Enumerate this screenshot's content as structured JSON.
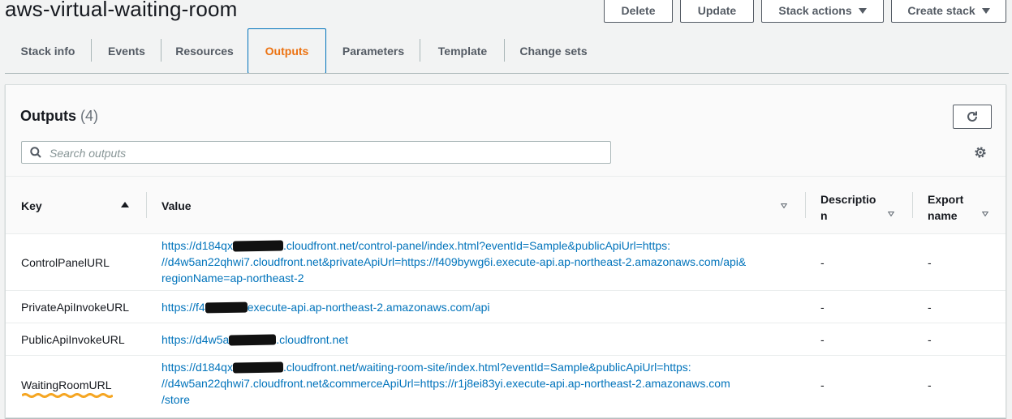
{
  "header": {
    "title": "aws-virtual-waiting-room",
    "buttons": {
      "delete": "Delete",
      "update": "Update",
      "stack_actions": "Stack actions",
      "create_stack": "Create stack"
    }
  },
  "tabs": [
    "Stack info",
    "Events",
    "Resources",
    "Outputs",
    "Parameters",
    "Template",
    "Change sets"
  ],
  "active_tab": "Outputs",
  "outputs": {
    "title": "Outputs",
    "count": "(4)",
    "search_placeholder": "Search outputs",
    "columns": {
      "key": "Key",
      "value": "Value",
      "description_1": "Descriptio",
      "description_2": "n",
      "export_1": "Export",
      "export_2": "name"
    },
    "rows": [
      {
        "key": "ControlPanelURL",
        "value_lines": [
          [
            "https://d184qx",
            ".cloudfront.net/control-panel/index.html?eventId=Sample&publicApiUrl=https:"
          ],
          [
            "//d4w5an22qhwi7.cloudfront.net&privateApiUrl=https://f409bywg6i.execute-api.ap-northeast-2.amazonaws.com/api&"
          ],
          [
            "regionName=ap-northeast-2"
          ]
        ],
        "description": "-",
        "export_name": "-"
      },
      {
        "key": "PrivateApiInvokeURL",
        "value_lines": [
          [
            "https://f4",
            "execute-api.ap-northeast-2.amazonaws.com/api"
          ]
        ],
        "description": "-",
        "export_name": "-"
      },
      {
        "key": "PublicApiInvokeURL",
        "value_lines": [
          [
            "https://d4w5a",
            ".cloudfront.net"
          ]
        ],
        "description": "-",
        "export_name": "-"
      },
      {
        "key": "WaitingRoomURL",
        "value_lines": [
          [
            "https://d184qx",
            ".cloudfront.net/waiting-room-site/index.html?eventId=Sample&publicApiUrl=https:"
          ],
          [
            "//d4w5an22qhwi7.cloudfront.net&commerceApiUrl=https://r1j8ei83yi.execute-api.ap-northeast-2.amazonaws.com"
          ],
          [
            "/store"
          ]
        ],
        "description": "-",
        "export_name": "-"
      }
    ]
  },
  "colors": {
    "accent": "#ec7211",
    "link": "#0073bb",
    "border_focus": "#0073bb"
  },
  "icons": {
    "refresh": "refresh-icon",
    "search": "search-icon",
    "settings": "gear-icon"
  }
}
